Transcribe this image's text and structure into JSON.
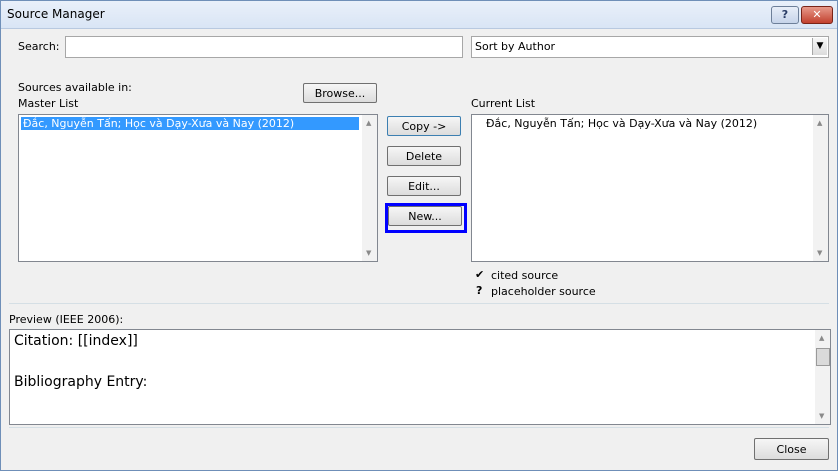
{
  "window": {
    "title": "Source Manager",
    "help_glyph": "?",
    "close_glyph": "✕"
  },
  "search": {
    "label": "Search:",
    "value": ""
  },
  "sort": {
    "selected": "Sort by Author",
    "arrow_glyph": "▼"
  },
  "sources_available_label": "Sources available in:",
  "master_list": {
    "label": "Master List",
    "items": [
      "Đắc, Nguyễn Tấn; Học và Dạy-Xưa và Nay (2012)"
    ]
  },
  "browse_label": "Browse...",
  "buttons": {
    "copy": "Copy ->",
    "delete": "Delete",
    "edit": "Edit...",
    "new": "New..."
  },
  "current_list": {
    "label": "Current List",
    "items": [
      "Đắc, Nguyễn Tấn; Học và Dạy-Xưa và Nay (2012)"
    ]
  },
  "legend": {
    "cited_glyph": "✔",
    "cited_label": "cited source",
    "placeholder_glyph": "?",
    "placeholder_label": "placeholder source"
  },
  "preview": {
    "label": "Preview (IEEE 2006):",
    "citation": "Citation:  [[index]]",
    "bibliography": "Bibliography Entry:"
  },
  "close_label": "Close",
  "scroll": {
    "up": "▲",
    "down": "▼"
  },
  "colors": {
    "accent_focus": "#0000ff",
    "selection": "#3399ff"
  }
}
